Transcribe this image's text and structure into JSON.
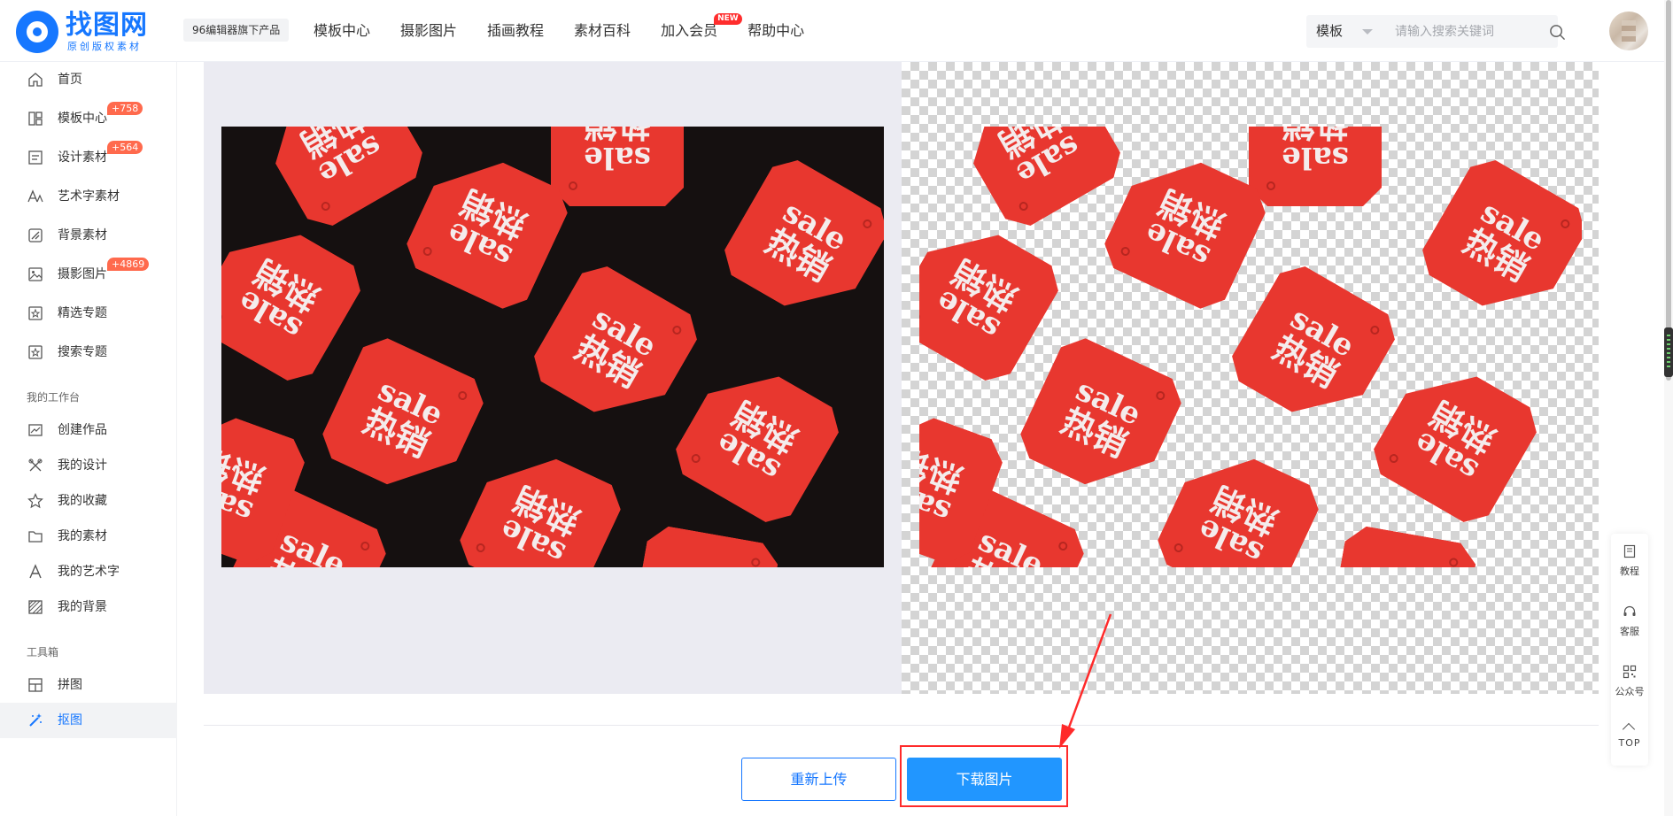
{
  "header": {
    "logo_name": "找图网",
    "logo_sub": "原创版权素材",
    "product_badge": "96编辑器旗下产品",
    "nav": [
      {
        "label": "模板中心"
      },
      {
        "label": "摄影图片"
      },
      {
        "label": "插画教程"
      },
      {
        "label": "素材百科"
      },
      {
        "label": "加入会员",
        "tag": "NEW"
      },
      {
        "label": "帮助中心"
      }
    ],
    "search": {
      "category": "模板",
      "placeholder": "请输入搜索关键词"
    }
  },
  "sidebar": {
    "items": [
      {
        "label": "首页",
        "icon": "home-icon"
      },
      {
        "label": "模板中心",
        "icon": "template-icon",
        "badge": "+758"
      },
      {
        "label": "设计素材",
        "icon": "design-material-icon",
        "badge": "+564"
      },
      {
        "label": "艺术字素材",
        "icon": "art-text-icon"
      },
      {
        "label": "背景素材",
        "icon": "background-icon"
      },
      {
        "label": "摄影图片",
        "icon": "photo-icon",
        "badge": "+4869"
      },
      {
        "label": "精选专题",
        "icon": "star-box-icon"
      },
      {
        "label": "搜索专题",
        "icon": "star-box-icon"
      }
    ],
    "workspace_title": "我的工作台",
    "workspace_items": [
      {
        "label": "创建作品",
        "icon": "create-icon"
      },
      {
        "label": "我的设计",
        "icon": "design-icon"
      },
      {
        "label": "我的收藏",
        "icon": "star-icon"
      },
      {
        "label": "我的素材",
        "icon": "folder-icon"
      },
      {
        "label": "我的艺术字",
        "icon": "letter-a-icon"
      },
      {
        "label": "我的背景",
        "icon": "texture-icon"
      }
    ],
    "toolbox_title": "工具箱",
    "toolbox_items": [
      {
        "label": "拼图",
        "icon": "collage-icon"
      },
      {
        "label": "抠图",
        "icon": "magic-wand-icon",
        "active": true
      }
    ]
  },
  "main": {
    "tag_text_top": "sale",
    "tag_text_bottom": "热销",
    "reupload_label": "重新上传",
    "download_label": "下载图片"
  },
  "float_bar": {
    "items": [
      {
        "label": "教程",
        "icon": "doc-icon"
      },
      {
        "label": "客服",
        "icon": "headset-icon"
      },
      {
        "label": "公众号",
        "icon": "qrcode-icon"
      },
      {
        "label": "TOP",
        "icon": "arrow-up-icon"
      }
    ]
  },
  "colors": {
    "brand": "#1677ff",
    "download_button": "#2196ff",
    "tag_red": "#e8372f",
    "annotation_red": "#ff2a2a",
    "badge_orange": "#ff6a4d"
  }
}
